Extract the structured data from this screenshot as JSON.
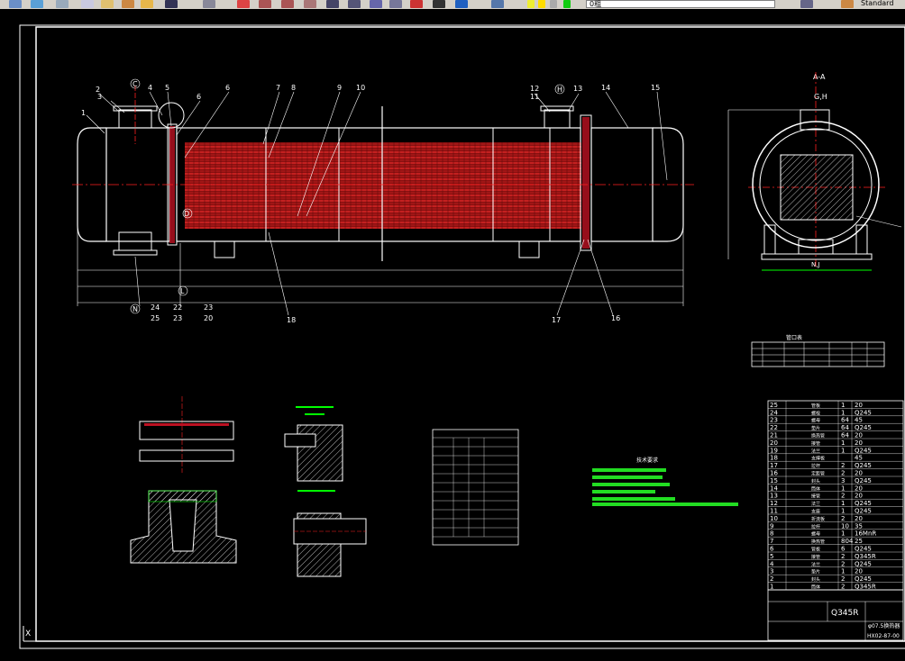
{
  "toolbar": {
    "layer_name": "0粗",
    "text_style": "Standard"
  },
  "drawing": {
    "section_label": "A-A",
    "section_nozzles": "G,H",
    "bottom_nozzles": "N,J",
    "balloons_top": [
      "1",
      "2",
      "3",
      "4",
      "5",
      "6",
      "7",
      "8",
      "9",
      "10",
      "11",
      "12",
      "13",
      "14",
      "15"
    ],
    "balloons_bottom": [
      "24",
      "25",
      "22",
      "23",
      "23",
      "20",
      "18",
      "17",
      "16"
    ],
    "circle_labels": [
      "C",
      "D",
      "H",
      "E",
      "N",
      "L"
    ],
    "tech_title": "技术要求",
    "nozzle_table_title": "管口表",
    "parts_material_footer": "Q345R",
    "title_block_name": "φ07.5换热器",
    "drawing_number": "HX02-87-00"
  },
  "bom": [
    {
      "no": "25",
      "name": "管板",
      "qty": "1",
      "mat": "20"
    },
    {
      "no": "24",
      "name": "螺栓",
      "qty": "1",
      "mat": "Q245"
    },
    {
      "no": "23",
      "name": "螺母",
      "qty": "64",
      "mat": "45"
    },
    {
      "no": "22",
      "name": "垫片",
      "qty": "64",
      "mat": "Q245"
    },
    {
      "no": "21",
      "name": "换热管",
      "qty": "64",
      "mat": "20"
    },
    {
      "no": "20",
      "name": "接管",
      "qty": "1",
      "mat": "20"
    },
    {
      "no": "19",
      "name": "法兰",
      "qty": "1",
      "mat": "Q245"
    },
    {
      "no": "18",
      "name": "支撑板",
      "qty": "",
      "mat": "45"
    },
    {
      "no": "17",
      "name": "拉杆",
      "qty": "2",
      "mat": "Q245"
    },
    {
      "no": "16",
      "name": "定距管",
      "qty": "2",
      "mat": "20"
    },
    {
      "no": "15",
      "name": "封头",
      "qty": "3",
      "mat": "Q245"
    },
    {
      "no": "14",
      "name": "筒体",
      "qty": "1",
      "mat": "20"
    },
    {
      "no": "13",
      "name": "接管",
      "qty": "2",
      "mat": "20"
    },
    {
      "no": "12",
      "name": "法兰",
      "qty": "1",
      "mat": "Q245"
    },
    {
      "no": "11",
      "name": "支座",
      "qty": "1",
      "mat": "Q245"
    },
    {
      "no": "10",
      "name": "折流板",
      "qty": "2",
      "mat": "20"
    },
    {
      "no": "9",
      "name": "拉杆",
      "qty": "10",
      "mat": "35"
    },
    {
      "no": "8",
      "name": "螺母",
      "qty": "1",
      "mat": "16MnR"
    },
    {
      "no": "7",
      "name": "换热管",
      "qty": "804",
      "mat": "25"
    },
    {
      "no": "6",
      "name": "管板",
      "qty": "6",
      "mat": "Q245"
    },
    {
      "no": "5",
      "name": "接管",
      "qty": "2",
      "mat": "Q345R"
    },
    {
      "no": "4",
      "name": "法兰",
      "qty": "2",
      "mat": "Q245"
    },
    {
      "no": "3",
      "name": "垫片",
      "qty": "1",
      "mat": "20"
    },
    {
      "no": "2",
      "name": "封头",
      "qty": "2",
      "mat": "Q245"
    },
    {
      "no": "1",
      "name": "筒体",
      "qty": "2",
      "mat": "Q345R"
    }
  ]
}
